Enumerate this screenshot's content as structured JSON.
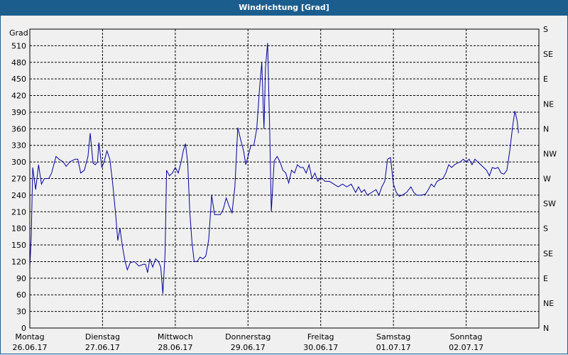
{
  "window": {
    "title": "Windrichtung [Grad]"
  },
  "colors": {
    "titlebar": "#1b5e8e",
    "series": "#0000a0",
    "grid": "#000000",
    "background": "#f0f0f0"
  },
  "chart_data": {
    "type": "line",
    "title": "Windrichtung [Grad]",
    "ylabel": "Grad",
    "ylim": [
      0,
      540
    ],
    "yticks": [
      0,
      30,
      60,
      90,
      120,
      150,
      180,
      210,
      240,
      270,
      300,
      330,
      360,
      390,
      420,
      450,
      480,
      510
    ],
    "right_axis_ticks": [
      {
        "value": 0,
        "label": "N"
      },
      {
        "value": 45,
        "label": "NE"
      },
      {
        "value": 90,
        "label": "E"
      },
      {
        "value": 135,
        "label": "SE"
      },
      {
        "value": 180,
        "label": "S"
      },
      {
        "value": 225,
        "label": "SW"
      },
      {
        "value": 270,
        "label": "W"
      },
      {
        "value": 315,
        "label": "NW"
      },
      {
        "value": 360,
        "label": "N"
      },
      {
        "value": 405,
        "label": "NE"
      },
      {
        "value": 450,
        "label": "E"
      },
      {
        "value": 495,
        "label": "SE"
      },
      {
        "value": 540,
        "label": "S"
      }
    ],
    "xlim": [
      0,
      7
    ],
    "x_unit": "days since Montag 26.06.17",
    "xticks": [
      {
        "value": 0,
        "day": "Montag",
        "date": "26.06.17"
      },
      {
        "value": 1,
        "day": "Dienstag",
        "date": "27.06.17"
      },
      {
        "value": 2,
        "day": "Mittwoch",
        "date": "28.06.17"
      },
      {
        "value": 3,
        "day": "Donnerstag",
        "date": "29.06.17"
      },
      {
        "value": 4,
        "day": "Freitag",
        "date": "30.06.17"
      },
      {
        "value": 5,
        "day": "Samstag",
        "date": "01.07.17"
      },
      {
        "value": 6,
        "day": "Sonntag",
        "date": "02.07.17"
      }
    ],
    "grid": true,
    "series": [
      {
        "points": [
          [
            0.0,
            110
          ],
          [
            0.02,
            165
          ],
          [
            0.04,
            290
          ],
          [
            0.08,
            250
          ],
          [
            0.12,
            295
          ],
          [
            0.16,
            260
          ],
          [
            0.2,
            270
          ],
          [
            0.26,
            270
          ],
          [
            0.3,
            280
          ],
          [
            0.36,
            310
          ],
          [
            0.4,
            305
          ],
          [
            0.46,
            300
          ],
          [
            0.5,
            292
          ],
          [
            0.55,
            300
          ],
          [
            0.62,
            305
          ],
          [
            0.66,
            305
          ],
          [
            0.7,
            280
          ],
          [
            0.75,
            285
          ],
          [
            0.8,
            310
          ],
          [
            0.83,
            352
          ],
          [
            0.87,
            298
          ],
          [
            0.9,
            295
          ],
          [
            0.93,
            300
          ],
          [
            0.95,
            335
          ],
          [
            0.99,
            290
          ],
          [
            1.02,
            300
          ],
          [
            1.06,
            320
          ],
          [
            1.1,
            305
          ],
          [
            1.14,
            260
          ],
          [
            1.18,
            205
          ],
          [
            1.21,
            158
          ],
          [
            1.24,
            180
          ],
          [
            1.27,
            150
          ],
          [
            1.31,
            120
          ],
          [
            1.34,
            105
          ],
          [
            1.38,
            118
          ],
          [
            1.44,
            120
          ],
          [
            1.5,
            112
          ],
          [
            1.56,
            115
          ],
          [
            1.59,
            115
          ],
          [
            1.62,
            100
          ],
          [
            1.65,
            125
          ],
          [
            1.69,
            110
          ],
          [
            1.73,
            125
          ],
          [
            1.77,
            120
          ],
          [
            1.8,
            110
          ],
          [
            1.83,
            62
          ],
          [
            1.86,
            135
          ],
          [
            1.88,
            285
          ],
          [
            1.92,
            275
          ],
          [
            1.96,
            280
          ],
          [
            2.0,
            290
          ],
          [
            2.04,
            280
          ],
          [
            2.08,
            300
          ],
          [
            2.11,
            320
          ],
          [
            2.14,
            333
          ],
          [
            2.17,
            300
          ],
          [
            2.2,
            210
          ],
          [
            2.23,
            155
          ],
          [
            2.26,
            120
          ],
          [
            2.3,
            120
          ],
          [
            2.34,
            128
          ],
          [
            2.38,
            125
          ],
          [
            2.42,
            130
          ],
          [
            2.46,
            160
          ],
          [
            2.5,
            240
          ],
          [
            2.54,
            205
          ],
          [
            2.58,
            205
          ],
          [
            2.62,
            205
          ],
          [
            2.66,
            215
          ],
          [
            2.7,
            235
          ],
          [
            2.74,
            220
          ],
          [
            2.78,
            208
          ],
          [
            2.82,
            255
          ],
          [
            2.86,
            362
          ],
          [
            2.9,
            340
          ],
          [
            2.94,
            320
          ],
          [
            2.97,
            295
          ],
          [
            3.0,
            310
          ],
          [
            3.04,
            330
          ],
          [
            3.08,
            330
          ],
          [
            3.12,
            360
          ],
          [
            3.16,
            435
          ],
          [
            3.19,
            480
          ],
          [
            3.22,
            360
          ],
          [
            3.24,
            470
          ],
          [
            3.27,
            515
          ],
          [
            3.3,
            350
          ],
          [
            3.32,
            210
          ],
          [
            3.34,
            255
          ],
          [
            3.36,
            302
          ],
          [
            3.4,
            310
          ],
          [
            3.44,
            300
          ],
          [
            3.48,
            285
          ],
          [
            3.52,
            280
          ],
          [
            3.56,
            262
          ],
          [
            3.6,
            285
          ],
          [
            3.64,
            280
          ],
          [
            3.68,
            295
          ],
          [
            3.72,
            290
          ],
          [
            3.76,
            290
          ],
          [
            3.8,
            280
          ],
          [
            3.84,
            295
          ],
          [
            3.88,
            270
          ],
          [
            3.92,
            280
          ],
          [
            3.96,
            265
          ],
          [
            4.0,
            272
          ],
          [
            4.06,
            265
          ],
          [
            4.12,
            265
          ],
          [
            4.18,
            260
          ],
          [
            4.24,
            255
          ],
          [
            4.3,
            260
          ],
          [
            4.36,
            255
          ],
          [
            4.42,
            260
          ],
          [
            4.48,
            245
          ],
          [
            4.52,
            255
          ],
          [
            4.56,
            245
          ],
          [
            4.6,
            250
          ],
          [
            4.64,
            240
          ],
          [
            4.7,
            245
          ],
          [
            4.76,
            250
          ],
          [
            4.8,
            240
          ],
          [
            4.84,
            255
          ],
          [
            4.88,
            265
          ],
          [
            4.92,
            305
          ],
          [
            4.96,
            308
          ],
          [
            5.0,
            260
          ],
          [
            5.04,
            245
          ],
          [
            5.08,
            238
          ],
          [
            5.12,
            240
          ],
          [
            5.18,
            245
          ],
          [
            5.24,
            255
          ],
          [
            5.28,
            245
          ],
          [
            5.32,
            240
          ],
          [
            5.38,
            240
          ],
          [
            5.44,
            242
          ],
          [
            5.48,
            250
          ],
          [
            5.52,
            260
          ],
          [
            5.56,
            255
          ],
          [
            5.6,
            265
          ],
          [
            5.64,
            268
          ],
          [
            5.68,
            270
          ],
          [
            5.72,
            280
          ],
          [
            5.76,
            295
          ],
          [
            5.8,
            290
          ],
          [
            5.84,
            295
          ],
          [
            5.88,
            298
          ],
          [
            5.92,
            300
          ],
          [
            5.96,
            305
          ],
          [
            6.0,
            300
          ],
          [
            6.04,
            305
          ],
          [
            6.08,
            295
          ],
          [
            6.12,
            305
          ],
          [
            6.16,
            300
          ],
          [
            6.2,
            295
          ],
          [
            6.24,
            290
          ],
          [
            6.28,
            285
          ],
          [
            6.32,
            275
          ],
          [
            6.36,
            290
          ],
          [
            6.4,
            288
          ],
          [
            6.44,
            290
          ],
          [
            6.48,
            280
          ],
          [
            6.52,
            278
          ],
          [
            6.56,
            285
          ],
          [
            6.6,
            320
          ],
          [
            6.64,
            365
          ],
          [
            6.67,
            392
          ],
          [
            6.7,
            375
          ],
          [
            6.72,
            352
          ]
        ]
      }
    ]
  }
}
